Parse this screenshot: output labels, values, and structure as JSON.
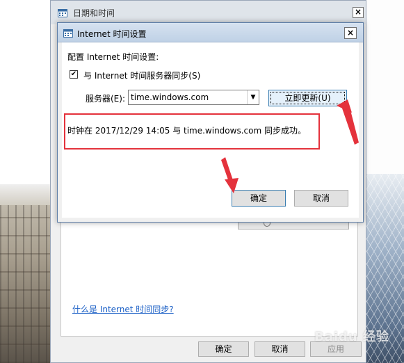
{
  "outer_dialog": {
    "title": "日期和时间",
    "close_glyph": "×",
    "help_link": "什么是 Internet 时间同步?",
    "buttons": {
      "ok": "确定",
      "cancel": "取消",
      "apply": "应用"
    }
  },
  "inner_dialog": {
    "title": "Internet 时间设置",
    "close_glyph": "×",
    "config_label": "配置 Internet 时间设置:",
    "sync_checkbox": {
      "label": "与 Internet 时间服务器同步(S)",
      "checked": true,
      "check_glyph": "✔"
    },
    "server_label": "服务器(E):",
    "server_value": "time.windows.com",
    "dropdown_glyph": "▼",
    "update_button": "立即更新(U)",
    "status_message": "时钟在 2017/12/29 14:05 与 time.windows.com 同步成功。",
    "buttons": {
      "ok": "确定",
      "cancel": "取消"
    }
  },
  "watermark": "Baidu 经验",
  "colors": {
    "annotation_red": "#e4323c",
    "link_blue": "#1a5fc6"
  }
}
